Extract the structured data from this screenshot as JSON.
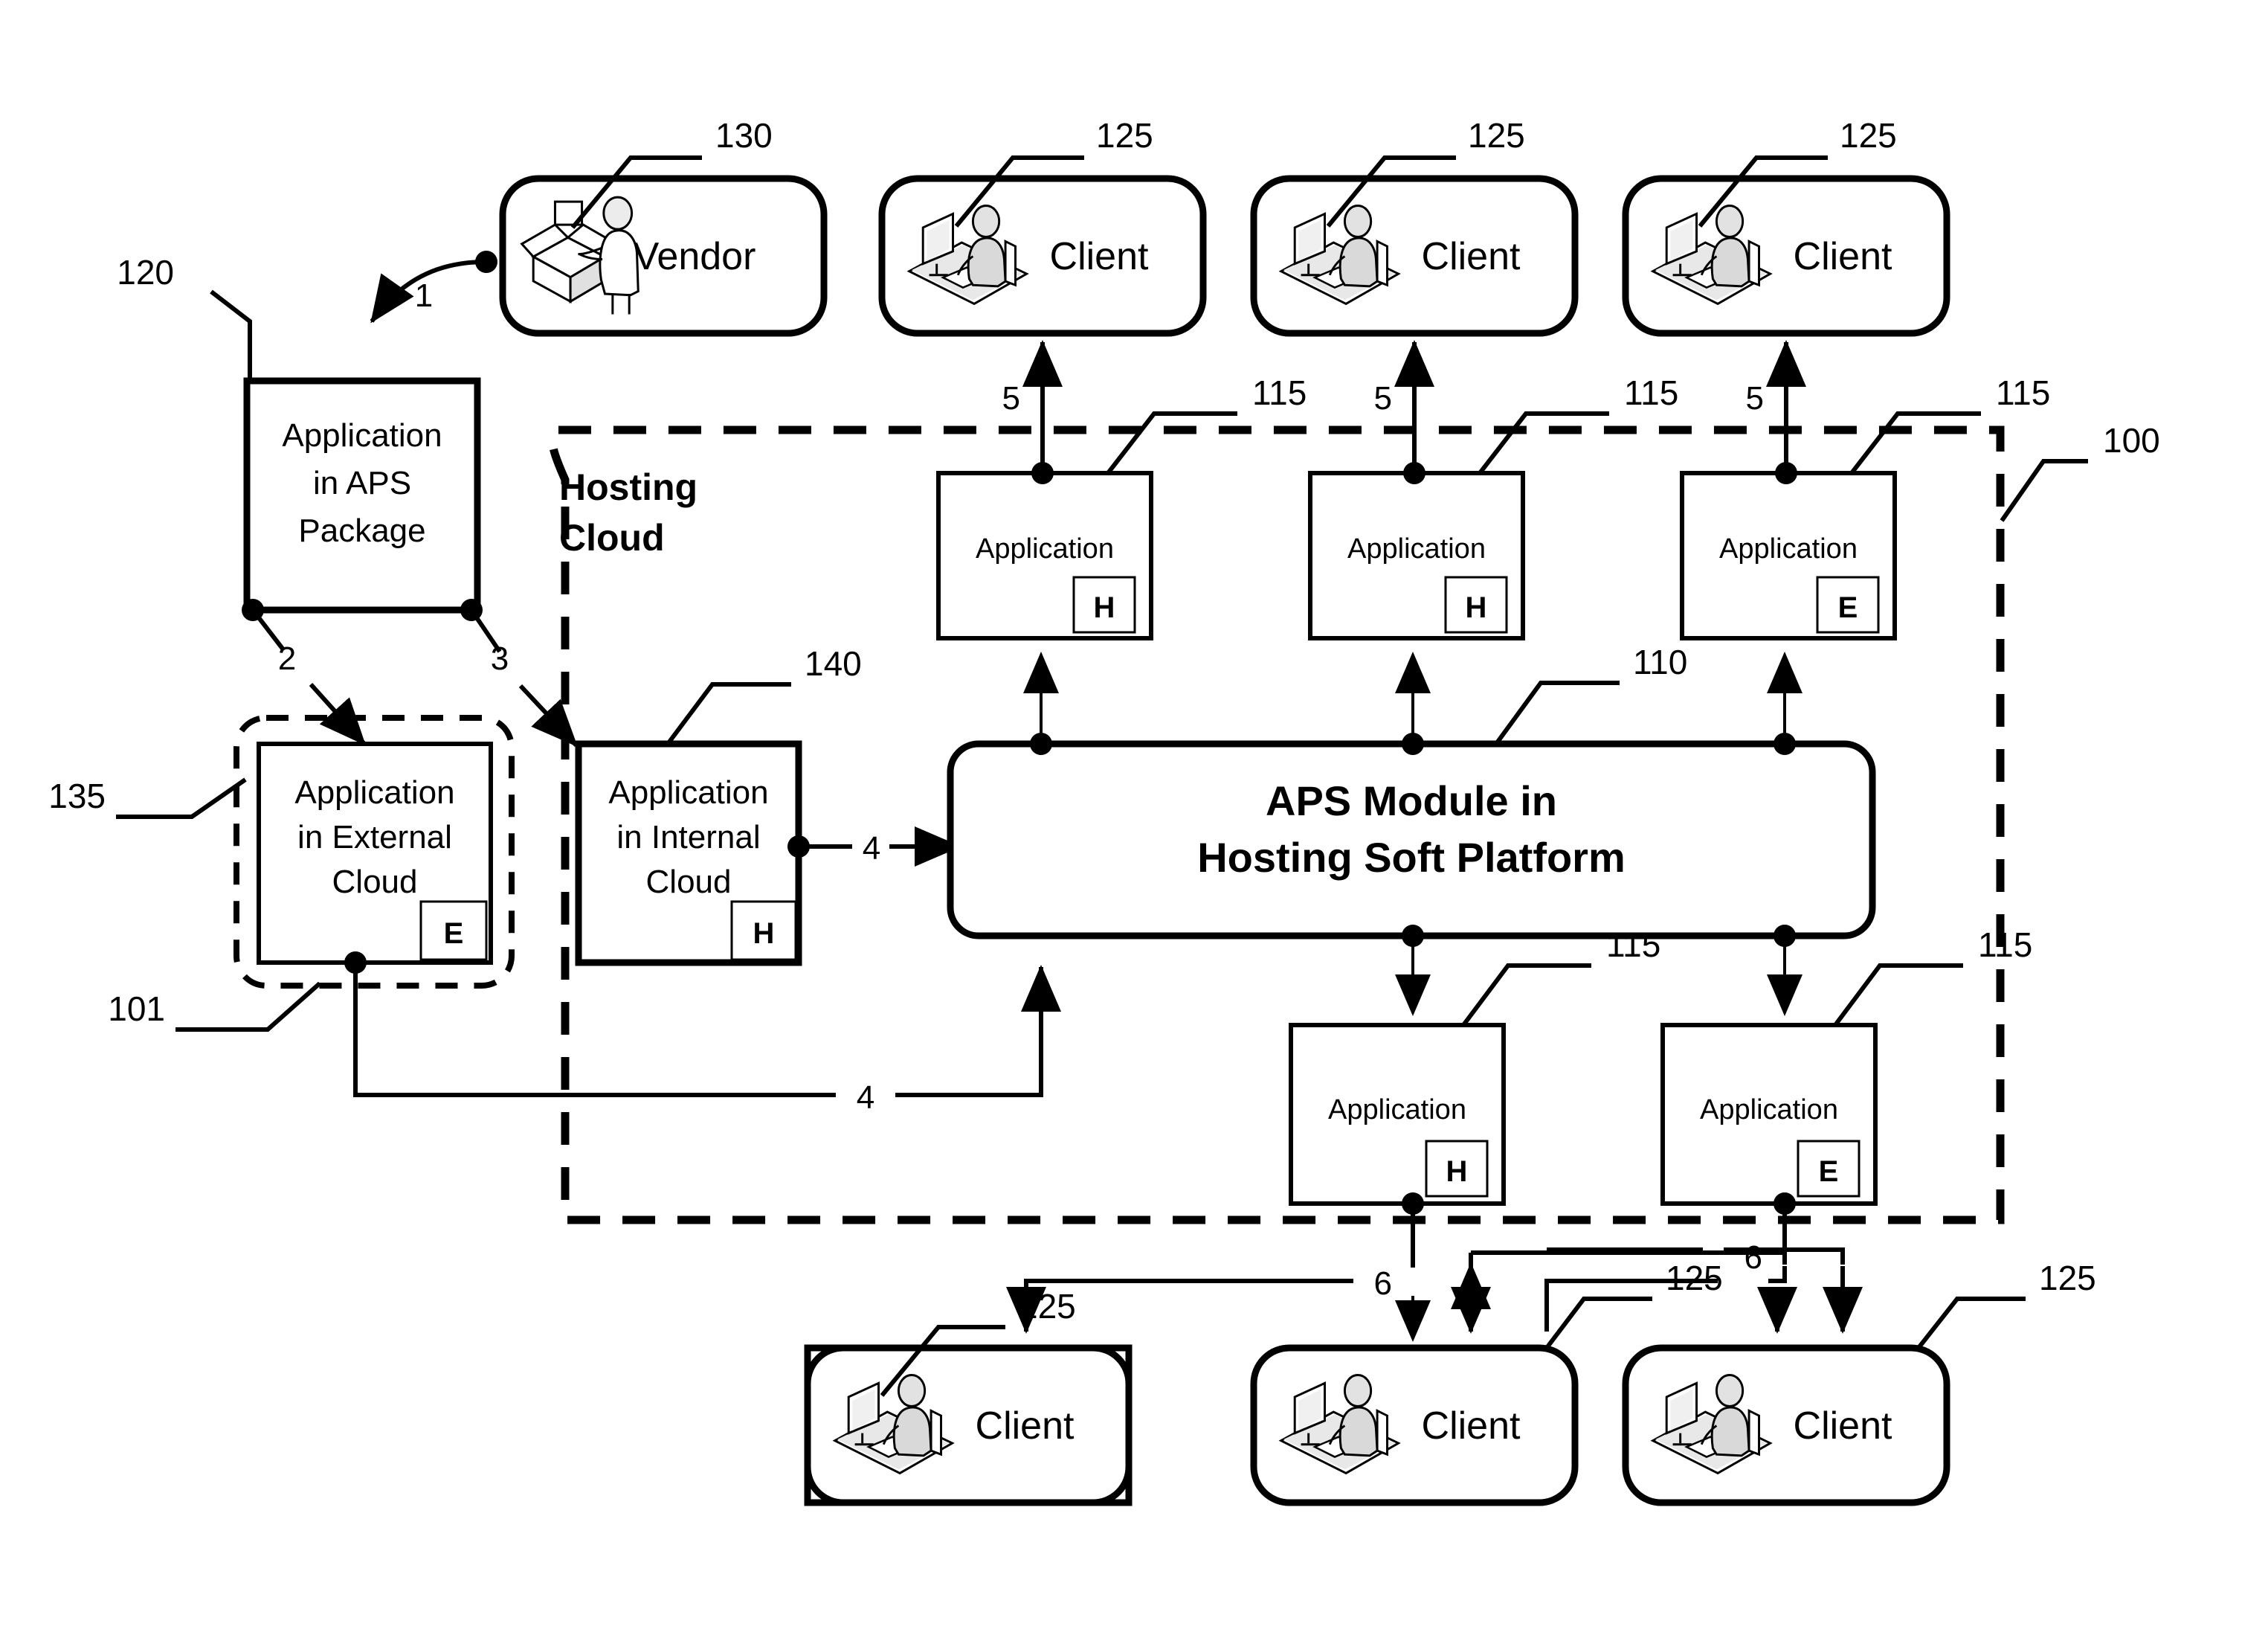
{
  "figure": {
    "type": "patent-block-diagram",
    "background_color": "#ffffff",
    "line_color": "#000000"
  },
  "reference_numerals": {
    "system": "100",
    "external_cloud_region": "101",
    "aps_module": "110",
    "application_instance": "115",
    "application_in_aps_package": "120",
    "client": "125",
    "vendor": "130",
    "application_in_external_cloud": "135",
    "application_in_internal_cloud": "140"
  },
  "flow_numbers": {
    "vendor_to_package": "1",
    "package_to_external": "2",
    "package_to_internal": "3",
    "cloud_to_module": "4",
    "application_to_client_top": "5",
    "application_to_client_bottom": "6"
  },
  "boundaries": {
    "hosting_cloud_label_line1": "Hosting",
    "hosting_cloud_label_line2": "Cloud",
    "system_ref": "100",
    "external_region_ref": "101"
  },
  "nodes": {
    "vendor": {
      "label": "Vendor",
      "ref": "130",
      "icon": "vendor-package-person-icon"
    },
    "aps_package": {
      "line1": "Application",
      "line2": "in APS",
      "line3": "Package",
      "ref": "120"
    },
    "external_cloud_app": {
      "line1": "Application",
      "line2": "in External",
      "line3": "Cloud",
      "badge": "E",
      "ref": "135"
    },
    "internal_cloud_app": {
      "line1": "Application",
      "line2": "in Internal",
      "line3": "Cloud",
      "badge": "H",
      "ref": "140"
    },
    "aps_module": {
      "line1": "APS Module in",
      "line2": "Hosting Soft Platform",
      "ref": "110"
    }
  },
  "top_clients": [
    {
      "label": "Client",
      "ref": "125",
      "icon": "client-workstation-icon"
    },
    {
      "label": "Client",
      "ref": "125",
      "icon": "client-workstation-icon"
    },
    {
      "label": "Client",
      "ref": "125",
      "icon": "client-workstation-icon"
    }
  ],
  "bottom_clients": [
    {
      "label": "Client",
      "ref": "125",
      "icon": "client-workstation-icon"
    },
    {
      "label": "Client",
      "ref": "125",
      "icon": "client-workstation-icon"
    },
    {
      "label": "Client",
      "ref": "125",
      "icon": "client-workstation-icon"
    }
  ],
  "top_applications": [
    {
      "label": "Application",
      "badge": "H",
      "ref": "115"
    },
    {
      "label": "Application",
      "badge": "H",
      "ref": "115"
    },
    {
      "label": "Application",
      "badge": "E",
      "ref": "115"
    }
  ],
  "bottom_applications": [
    {
      "label": "Application",
      "badge": "H",
      "ref": "115"
    },
    {
      "label": "Application",
      "badge": "E",
      "ref": "115"
    }
  ]
}
